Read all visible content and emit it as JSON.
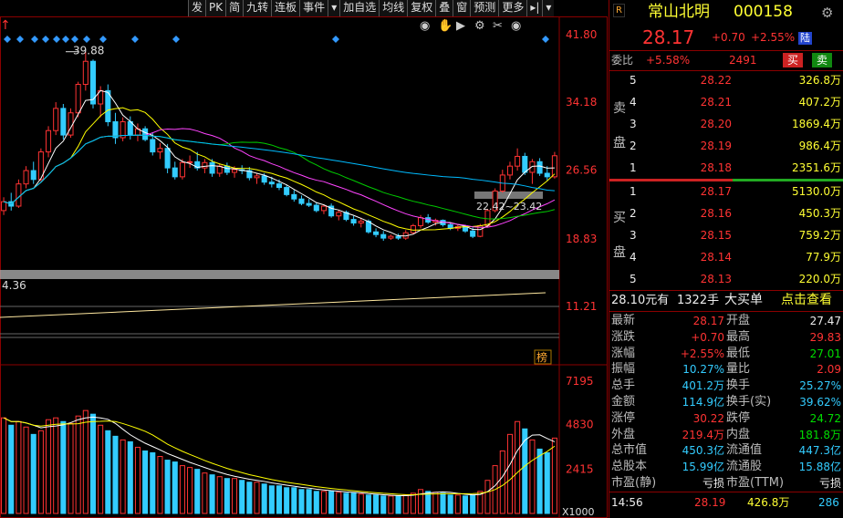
{
  "toolbar": [
    "发",
    "PK",
    "简",
    "九转",
    "连板",
    "事件",
    "▾",
    "加自选",
    "均线",
    "复权",
    "叠",
    "窗",
    "预测",
    "更多",
    "▸|",
    "▾"
  ],
  "colors": {
    "up": "#ff3333",
    "down": "#33ccff",
    "ma5": "#ffffff",
    "ma10": "#ffff00",
    "ma20": "#ff44ff",
    "ma30": "#00cc00",
    "ma60": "#00bbff"
  },
  "chart": {
    "price_ticks": [
      "41.80",
      "34.18",
      "26.56",
      "18.83",
      "11.21"
    ],
    "vol_ticks": [
      "7195",
      "4830",
      "2415"
    ],
    "vol_unit": "X1000",
    "high_label": "39.88",
    "low_label": "4.36",
    "range_label": "22.42~23.42",
    "bang_label": "榜",
    "icons": [
      "eye-icon",
      "hand-icon",
      "play-icon",
      "settings-icon",
      "scissors-icon",
      "eye2-icon"
    ]
  },
  "stock": {
    "badge": "R",
    "name": "常山北明",
    "code": "000158",
    "price": "28.17",
    "change": "+0.70",
    "pct": "+2.55%",
    "board": "陆"
  },
  "weibi": {
    "label": "委比",
    "pct": "+5.58%",
    "diff": "2491",
    "buy": "买",
    "sell": "卖"
  },
  "asks": [
    {
      "n": "5",
      "p": "28.22",
      "v": "326.8万"
    },
    {
      "n": "4",
      "p": "28.21",
      "v": "407.2万"
    },
    {
      "n": "3",
      "p": "28.20",
      "v": "1869.4万"
    },
    {
      "n": "2",
      "p": "28.19",
      "v": "986.4万"
    },
    {
      "n": "1",
      "p": "28.18",
      "v": "2351.6万"
    }
  ],
  "ask_label": [
    "卖",
    "盘"
  ],
  "bids": [
    {
      "n": "1",
      "p": "28.17",
      "v": "5130.0万"
    },
    {
      "n": "2",
      "p": "28.16",
      "v": "450.3万"
    },
    {
      "n": "3",
      "p": "28.15",
      "v": "759.2万"
    },
    {
      "n": "4",
      "p": "28.14",
      "v": "77.9万"
    },
    {
      "n": "5",
      "p": "28.13",
      "v": "220.0万"
    }
  ],
  "bid_label": [
    "买",
    "盘"
  ],
  "bigorder": {
    "price": "28.10元有",
    "qty": "1322手",
    "label": "大买单",
    "link": "点击查看"
  },
  "stats": [
    {
      "l": "最新",
      "v": "28.17",
      "vc": "red",
      "l2": "开盘",
      "v2": "27.47",
      "vc2": "white"
    },
    {
      "l": "涨跌",
      "v": "+0.70",
      "vc": "red",
      "l2": "最高",
      "v2": "29.83",
      "vc2": "red"
    },
    {
      "l": "涨幅",
      "v": "+2.55%",
      "vc": "red",
      "l2": "最低",
      "v2": "27.01",
      "vc2": "green"
    },
    {
      "l": "振幅",
      "v": "10.27%",
      "vc": "cyan",
      "l2": "量比",
      "v2": "2.09",
      "vc2": "red"
    },
    {
      "l": "总手",
      "v": "401.2万",
      "vc": "cyan",
      "l2": "换手",
      "v2": "25.27%",
      "vc2": "cyan"
    },
    {
      "l": "金额",
      "v": "114.9亿",
      "vc": "cyan",
      "l2": "换手(实)",
      "v2": "39.62%",
      "vc2": "cyan"
    },
    {
      "l": "涨停",
      "v": "30.22",
      "vc": "red",
      "l2": "跌停",
      "v2": "24.72",
      "vc2": "green"
    },
    {
      "l": "外盘",
      "v": "219.4万",
      "vc": "red",
      "l2": "内盘",
      "v2": "181.8万",
      "vc2": "green"
    },
    {
      "l": "总市值",
      "v": "450.3亿",
      "vc": "cyan",
      "l2": "流通值",
      "v2": "447.3亿",
      "vc2": "cyan"
    },
    {
      "l": "总股本",
      "v": "15.99亿",
      "vc": "cyan",
      "l2": "流通股",
      "v2": "15.88亿",
      "vc2": "cyan"
    },
    {
      "l": "市盈(静)",
      "v": "亏损",
      "vc": "white",
      "l2": "市盈(TTM)",
      "v2": "亏损",
      "vc2": "white"
    }
  ],
  "tick": {
    "time": "14:56",
    "price": "28.19",
    "vol": "426.8万",
    "num": "286"
  },
  "chart_data": {
    "type": "candlestick",
    "y_ticks": [
      41.8,
      34.18,
      26.56,
      18.83,
      11.21
    ],
    "volume_ticks": [
      7195,
      4830,
      2415
    ],
    "volume_unit": "X1000",
    "annotations": [
      "39.88",
      "4.36",
      "22.42~23.42"
    ],
    "ohlc": [
      [
        22.0,
        23.5,
        21.5,
        23.0
      ],
      [
        23.0,
        24.0,
        22.0,
        22.5
      ],
      [
        22.5,
        25.5,
        22.3,
        25.0
      ],
      [
        25.0,
        27.0,
        24.5,
        26.5
      ],
      [
        26.5,
        27.5,
        25.0,
        25.5
      ],
      [
        25.5,
        29.0,
        25.3,
        28.6
      ],
      [
        28.6,
        31.5,
        28.0,
        31.0
      ],
      [
        31.0,
        34.2,
        30.5,
        33.5
      ],
      [
        33.5,
        34.0,
        30.0,
        30.5
      ],
      [
        30.5,
        33.5,
        30.2,
        33.0
      ],
      [
        33.0,
        36.5,
        32.5,
        36.2
      ],
      [
        36.2,
        39.88,
        35.5,
        38.8
      ],
      [
        38.8,
        39.0,
        33.5,
        34.0
      ],
      [
        34.0,
        36.0,
        32.5,
        35.5
      ],
      [
        35.5,
        36.2,
        31.5,
        32.0
      ],
      [
        32.0,
        33.0,
        29.5,
        30.2
      ],
      [
        30.2,
        32.5,
        29.8,
        32.0
      ],
      [
        32.0,
        32.6,
        30.0,
        30.5
      ],
      [
        30.5,
        31.8,
        29.8,
        31.2
      ],
      [
        31.2,
        31.5,
        29.8,
        30.0
      ],
      [
        30.0,
        30.8,
        28.2,
        28.6
      ],
      [
        28.6,
        29.6,
        27.8,
        29.0
      ],
      [
        29.0,
        29.5,
        26.2,
        26.8
      ],
      [
        26.8,
        27.5,
        25.5,
        25.8
      ],
      [
        25.8,
        27.8,
        25.5,
        27.4
      ],
      [
        27.4,
        28.2,
        26.8,
        27.5
      ],
      [
        27.5,
        28.6,
        26.5,
        26.8
      ],
      [
        26.8,
        27.8,
        26.2,
        27.4
      ],
      [
        27.4,
        27.8,
        25.8,
        26.2
      ],
      [
        26.2,
        27.3,
        25.8,
        27.0
      ],
      [
        27.0,
        27.4,
        26.0,
        26.3
      ],
      [
        26.3,
        27.0,
        25.7,
        26.6
      ],
      [
        26.6,
        27.1,
        26.1,
        26.5
      ],
      [
        26.5,
        26.9,
        25.4,
        25.7
      ],
      [
        25.7,
        26.2,
        25.0,
        25.9
      ],
      [
        25.9,
        26.2,
        24.9,
        25.2
      ],
      [
        25.2,
        25.8,
        24.6,
        25.0
      ],
      [
        25.0,
        25.5,
        24.3,
        24.6
      ],
      [
        24.6,
        24.9,
        23.6,
        23.8
      ],
      [
        23.8,
        24.3,
        23.0,
        23.3
      ],
      [
        23.3,
        23.7,
        22.6,
        22.8
      ],
      [
        22.8,
        23.3,
        22.4,
        22.6
      ],
      [
        22.6,
        22.9,
        21.8,
        22.0
      ],
      [
        22.0,
        22.7,
        21.6,
        22.5
      ],
      [
        22.5,
        22.8,
        21.2,
        21.4
      ],
      [
        21.4,
        22.1,
        20.9,
        21.8
      ],
      [
        21.8,
        22.0,
        20.8,
        21.0
      ],
      [
        21.0,
        21.4,
        20.3,
        20.6
      ],
      [
        20.6,
        21.2,
        20.1,
        20.8
      ],
      [
        20.8,
        21.0,
        19.4,
        19.6
      ],
      [
        19.6,
        20.0,
        19.0,
        19.3
      ],
      [
        19.3,
        19.7,
        18.6,
        18.9
      ],
      [
        18.9,
        19.3,
        18.7,
        19.1
      ],
      [
        19.1,
        19.4,
        18.7,
        18.9
      ],
      [
        18.9,
        19.8,
        18.7,
        19.5
      ],
      [
        19.5,
        20.5,
        19.3,
        20.3
      ],
      [
        20.3,
        21.5,
        20.0,
        21.2
      ],
      [
        21.2,
        21.6,
        20.5,
        20.7
      ],
      [
        20.7,
        21.1,
        20.3,
        20.9
      ],
      [
        20.9,
        21.0,
        20.2,
        20.4
      ],
      [
        20.4,
        20.7,
        19.8,
        20.0
      ],
      [
        20.0,
        20.4,
        19.7,
        20.2
      ],
      [
        20.2,
        20.4,
        19.5,
        19.7
      ],
      [
        19.7,
        20.1,
        18.9,
        19.1
      ],
      [
        19.1,
        20.5,
        19.0,
        20.3
      ],
      [
        20.3,
        22.2,
        20.1,
        22.0
      ],
      [
        22.0,
        24.5,
        21.8,
        24.2
      ],
      [
        24.2,
        26.6,
        24.0,
        26.0
      ],
      [
        26.0,
        27.5,
        25.5,
        27.0
      ],
      [
        27.0,
        29.0,
        26.5,
        28.1
      ],
      [
        28.1,
        28.5,
        26.0,
        26.3
      ],
      [
        26.3,
        27.8,
        25.0,
        27.5
      ],
      [
        27.5,
        27.9,
        25.9,
        26.2
      ],
      [
        26.2,
        27.0,
        25.4,
        25.8
      ],
      [
        25.8,
        28.6,
        25.6,
        28.17
      ]
    ],
    "volume": [
      5200,
      4800,
      5000,
      4700,
      4300,
      4500,
      5100,
      5200,
      5000,
      4900,
      5300,
      5600,
      5400,
      4800,
      4500,
      4200,
      4000,
      3900,
      3600,
      3400,
      3300,
      3100,
      2900,
      2800,
      2600,
      2500,
      2400,
      2200,
      2100,
      2000,
      1900,
      1900,
      1800,
      1700,
      1700,
      1600,
      1500,
      1500,
      1400,
      1400,
      1300,
      1300,
      1200,
      1200,
      1200,
      1150,
      1100,
      1100,
      1050,
      1000,
      1000,
      950,
      950,
      950,
      1000,
      1100,
      1300,
      1200,
      1150,
      1100,
      1000,
      1000,
      950,
      1000,
      1200,
      1800,
      2600,
      3400,
      4300,
      5000,
      4600,
      4000,
      3500,
      3300,
      4100
    ]
  }
}
